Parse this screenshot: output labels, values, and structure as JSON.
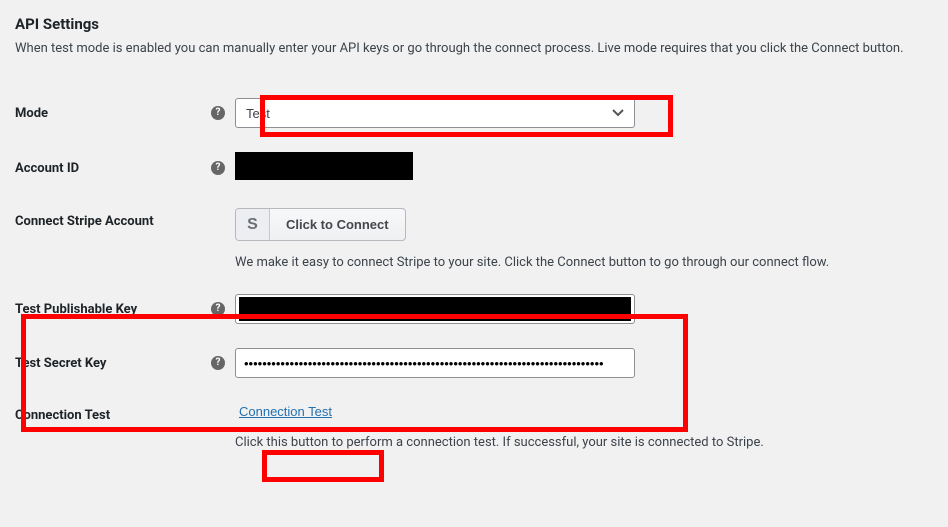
{
  "heading": "API Settings",
  "intro": "When test mode is enabled you can manually enter your API keys or go through the connect process. Live mode requires that you click the Connect button.",
  "fields": {
    "mode": {
      "label": "Mode",
      "selected": "Test"
    },
    "account_id": {
      "label": "Account ID"
    },
    "connect": {
      "label": "Connect Stripe Account",
      "button_label": "Click to Connect",
      "helper": "We make it easy to connect Stripe to your site. Click the Connect button to go through our connect flow."
    },
    "pub_key": {
      "label": "Test Publishable Key"
    },
    "secret_key": {
      "label": "Test Secret Key",
      "value": "•••••••••••••••••••••••••••••••••••••••••••••••••••••••••••••••••••••••••••••••"
    },
    "conn_test": {
      "label": "Connection Test",
      "button_label": "Connection Test",
      "helper": "Click this button to perform a connection test. If successful, your site is connected to Stripe."
    }
  }
}
